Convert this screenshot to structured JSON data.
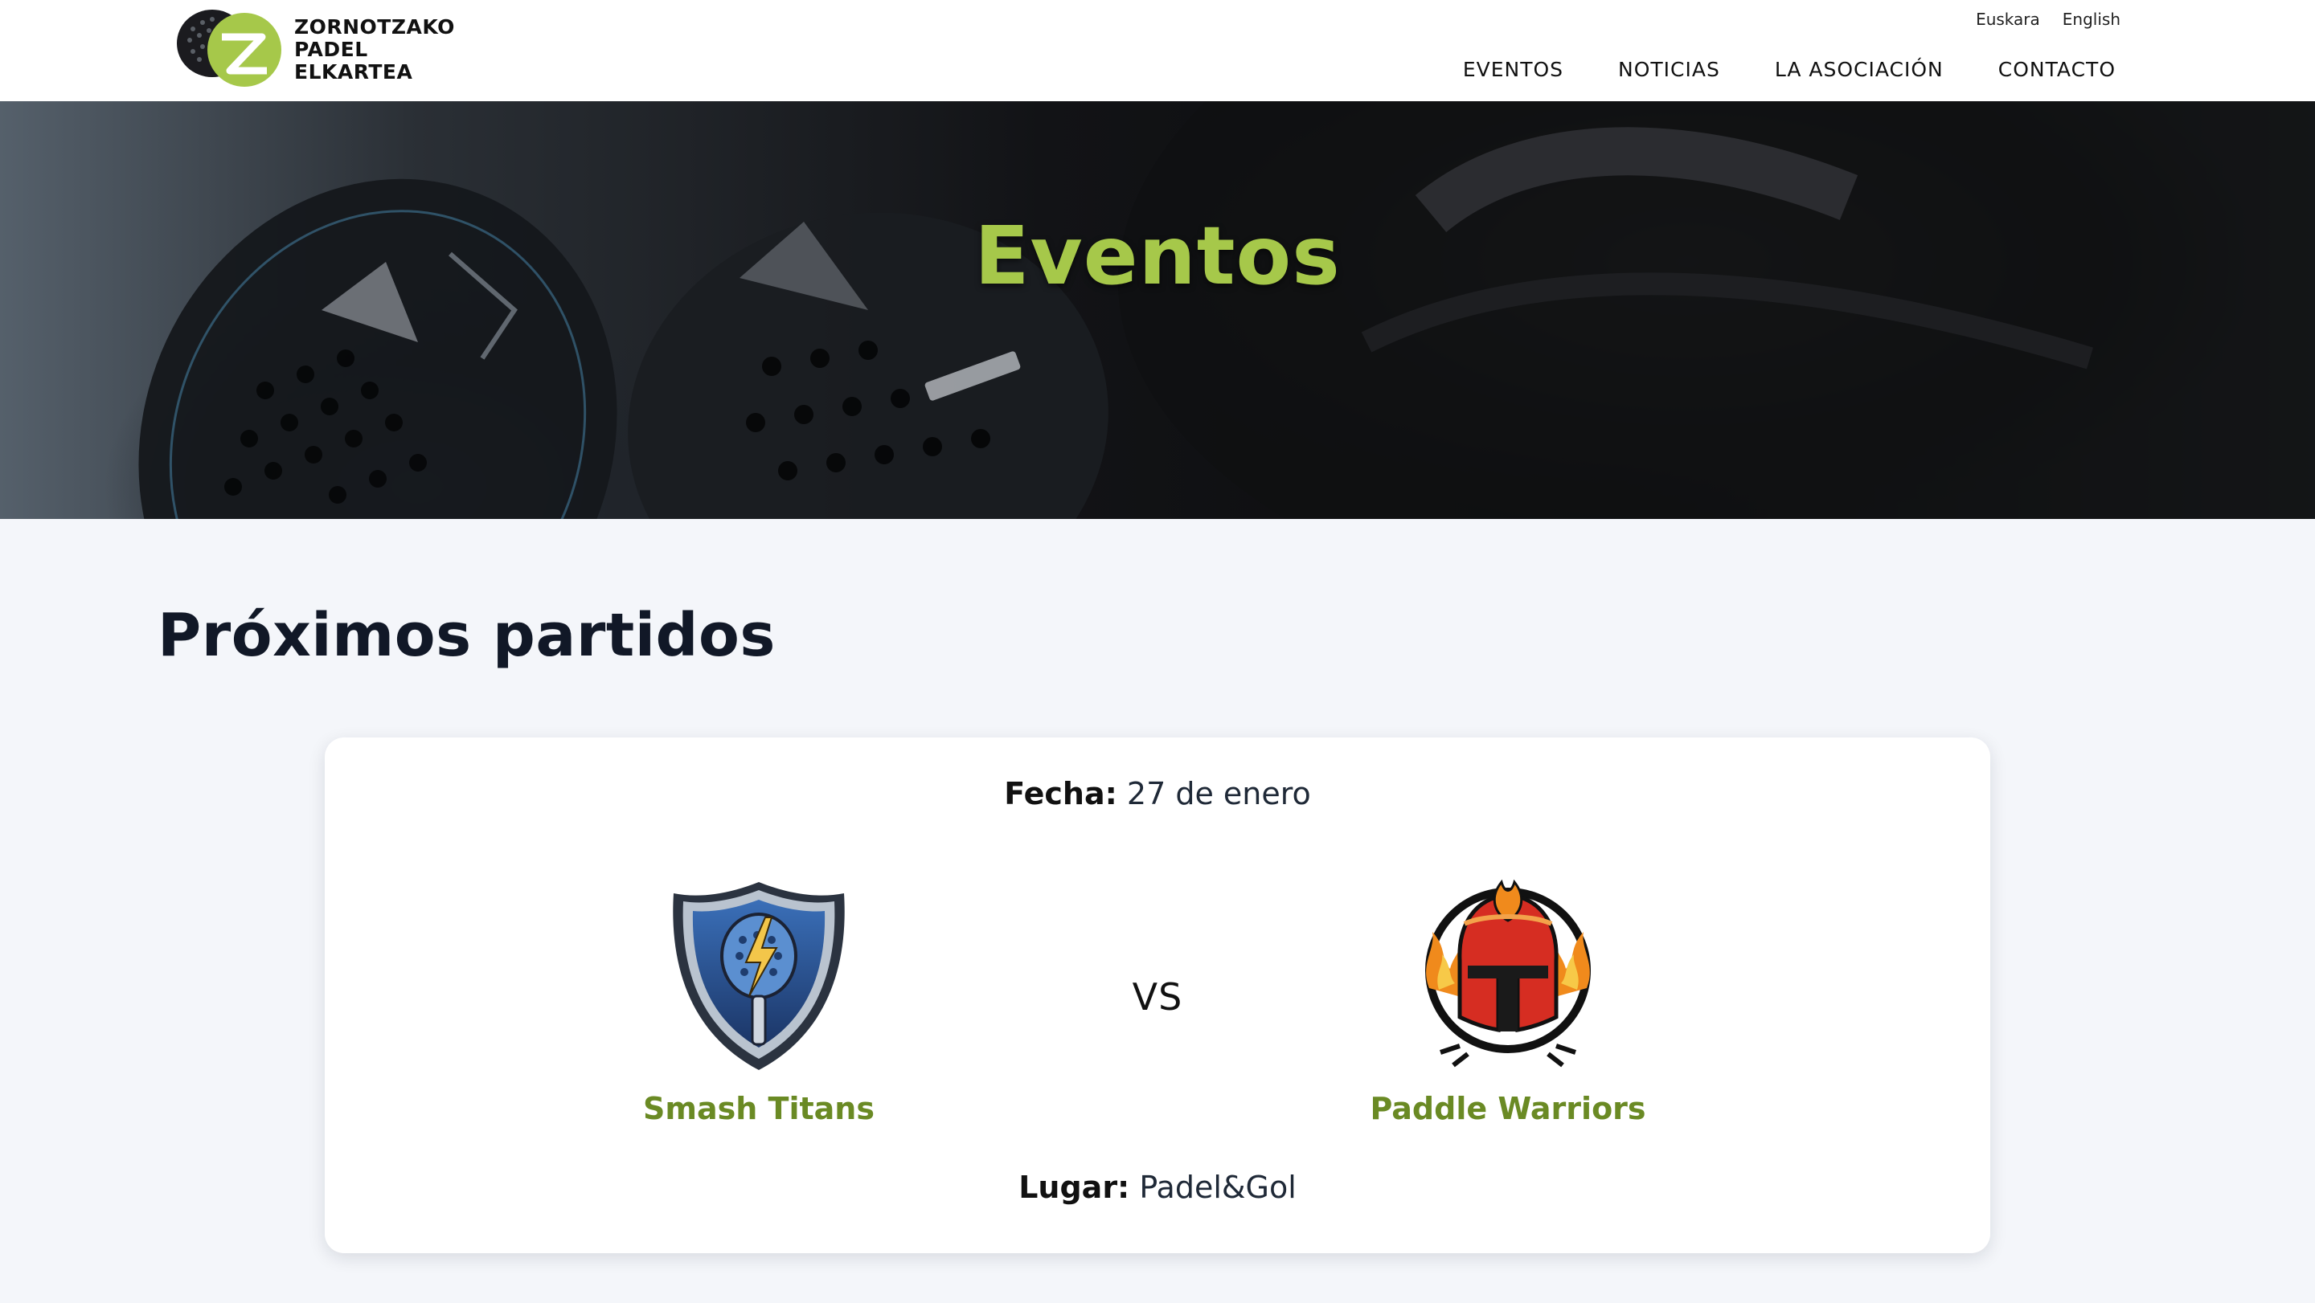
{
  "header": {
    "brand_lines": [
      "ZORNOTZAKO",
      "PADEL",
      "ELKARTEA"
    ],
    "languages": [
      "Euskara",
      "English"
    ],
    "nav": [
      "EVENTOS",
      "NOTICIAS",
      "LA ASOCIACIÓN",
      "CONTACTO"
    ]
  },
  "hero": {
    "title": "Eventos",
    "title_color": "#a6c84a"
  },
  "upcoming": {
    "section_title": "Próximos partidos",
    "match": {
      "date_label": "Fecha:",
      "date_value": "27 de enero",
      "home_team": {
        "name": "Smash Titans",
        "logo_icon": "shield-lightning-racket-icon"
      },
      "vs_text": "VS",
      "away_team": {
        "name": "Paddle Warriors",
        "logo_icon": "spartan-helmet-flames-icon"
      },
      "venue_label": "Lugar:",
      "venue_value": "Padel&Gol"
    }
  },
  "colors": {
    "accent_green": "#6a8a24",
    "page_background": "#f4f6fa",
    "card_background": "#ffffff"
  }
}
